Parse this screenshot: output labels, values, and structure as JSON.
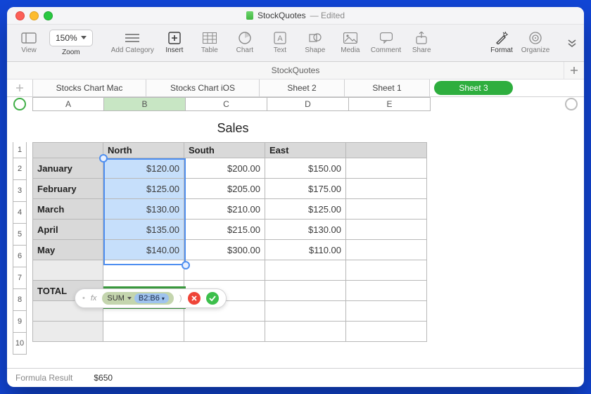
{
  "titlebar": {
    "doc": "StockQuotes",
    "state": "Edited"
  },
  "toolbar": {
    "view": "View",
    "zoom_label": "Zoom",
    "zoom_value": "150%",
    "add_category": "Add Category",
    "insert": "Insert",
    "table": "Table",
    "chart": "Chart",
    "text": "Text",
    "shape": "Shape",
    "media": "Media",
    "comment": "Comment",
    "share": "Share",
    "format": "Format",
    "organize": "Organize"
  },
  "docstrip": {
    "name": "StockQuotes"
  },
  "sheet_tabs": {
    "items": [
      "Stocks Chart Mac",
      "Stocks Chart iOS",
      "Sheet 2",
      "Sheet 1",
      "Sheet 3"
    ],
    "active": 4
  },
  "columns": [
    "A",
    "B",
    "C",
    "D",
    "E"
  ],
  "sheet": {
    "title": "Sales",
    "headers": [
      "",
      "North",
      "South",
      "East",
      ""
    ],
    "rows": [
      {
        "label": "January",
        "north": "$120.00",
        "south": "$200.00",
        "east": "$150.00"
      },
      {
        "label": "February",
        "north": "$125.00",
        "south": "$205.00",
        "east": "$175.00"
      },
      {
        "label": "March",
        "north": "$130.00",
        "south": "$210.00",
        "east": "$125.00"
      },
      {
        "label": "April",
        "north": "$135.00",
        "south": "$215.00",
        "east": "$130.00"
      },
      {
        "label": "May",
        "north": "$140.00",
        "south": "$300.00",
        "east": "$110.00"
      }
    ],
    "total_label": "TOTAL"
  },
  "chart_data": {
    "type": "table",
    "title": "Sales",
    "categories": [
      "January",
      "February",
      "March",
      "April",
      "May"
    ],
    "series": [
      {
        "name": "North",
        "values": [
          120.0,
          125.0,
          130.0,
          135.0,
          140.0
        ]
      },
      {
        "name": "South",
        "values": [
          200.0,
          205.0,
          210.0,
          215.0,
          300.0
        ]
      },
      {
        "name": "East",
        "values": [
          150.0,
          175.0,
          125.0,
          130.0,
          110.0
        ]
      }
    ],
    "currency": "USD"
  },
  "selection": {
    "range": "B2:B6",
    "sum": 650
  },
  "formula_editor": {
    "fx_label": "fx",
    "function": "SUM",
    "arg": "B2:B6"
  },
  "footer": {
    "label": "Formula Result",
    "value": "$650"
  },
  "colors": {
    "sheet_active": "#2eae3e",
    "selection": "#c6dffb",
    "formula_box": "#c4d5ae"
  }
}
